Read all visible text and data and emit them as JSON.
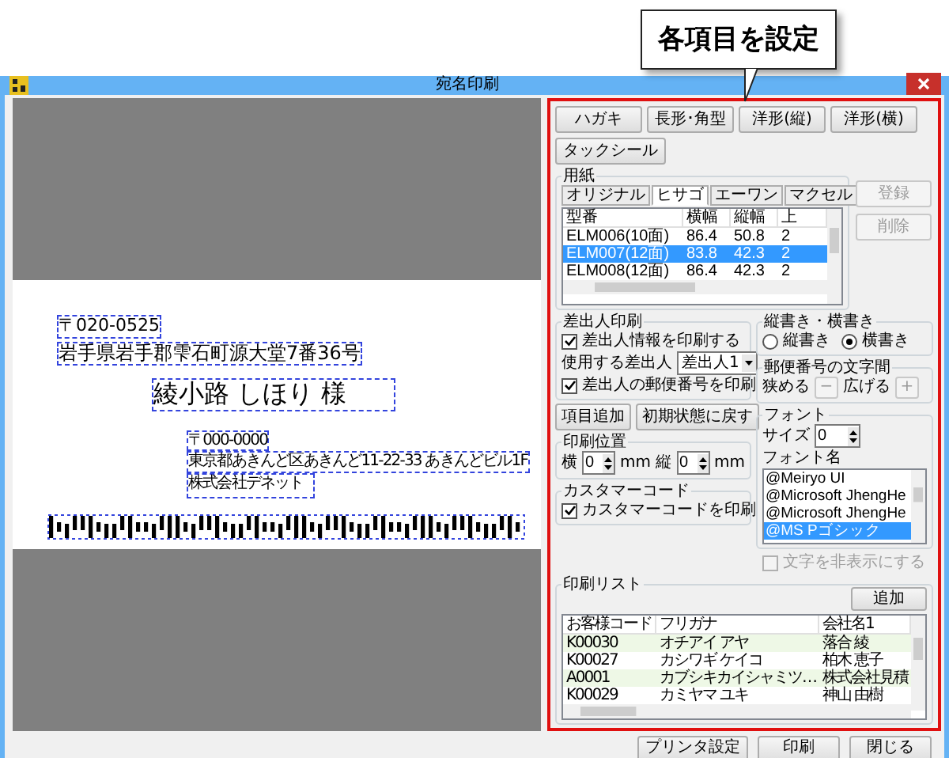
{
  "callout": {
    "text": "各項目を設定"
  },
  "window": {
    "title": "宛名印刷"
  },
  "preview": {
    "fields": [
      {
        "kind": "recipient_postal",
        "text": "〒020-0525"
      },
      {
        "kind": "recipient_address",
        "text": "岩手県岩手郡雫石町源大堂7番36号"
      },
      {
        "kind": "recipient_name",
        "text": "綾小路 しほり 様"
      },
      {
        "kind": "sender_postal",
        "text": "〒000-0000"
      },
      {
        "kind": "sender_address",
        "text": "東京都あきんど区あきんど11-22-33 あきんどビル1F"
      },
      {
        "kind": "sender_name",
        "text": "株式会社デネット"
      }
    ]
  },
  "size_buttons": [
    "ハガキ",
    "長形･角型",
    "洋形(縦)",
    "洋形(横)",
    "タックシール"
  ],
  "paper": {
    "label": "用紙",
    "tabs": [
      {
        "label": "オリジナル",
        "selected": false
      },
      {
        "label": "ヒサゴ",
        "selected": true
      },
      {
        "label": "エーワン",
        "selected": false
      },
      {
        "label": "マクセル",
        "selected": false
      }
    ],
    "columns": [
      "型番",
      "横幅",
      "縦幅",
      "上"
    ],
    "rows": [
      {
        "cells": [
          "ELM006(10面)",
          "86.4",
          "50.8",
          "2"
        ],
        "selected": false
      },
      {
        "cells": [
          "ELM007(12面)",
          "83.8",
          "42.3",
          "2"
        ],
        "selected": true
      },
      {
        "cells": [
          "ELM008(12面)",
          "86.4",
          "42.3",
          "2"
        ],
        "selected": false
      }
    ],
    "buttons": [
      {
        "label": "登録",
        "disabled": true
      },
      {
        "label": "削除",
        "disabled": true
      }
    ]
  },
  "sender": {
    "label": "差出人印刷",
    "print_sender": {
      "label": "差出人情報を印刷する",
      "checked": true
    },
    "select": {
      "label": "使用する差出人",
      "value": "差出人1"
    },
    "print_postal": {
      "label": "差出人の郵便番号を印刷",
      "checked": true
    }
  },
  "item_buttons": [
    "項目追加",
    "初期状態に戻す"
  ],
  "position": {
    "label": "印刷位置",
    "x_label": "横",
    "x_value": "0",
    "x_unit": "mm",
    "y_label": "縦",
    "y_value": "0",
    "y_unit": "mm"
  },
  "customer_code": {
    "label": "カスタマーコード",
    "checkbox": {
      "label": "カスタマーコードを印刷",
      "checked": true
    }
  },
  "orientation": {
    "label": "縦書き・横書き",
    "options": [
      {
        "label": "縦書き",
        "selected": false
      },
      {
        "label": "横書き",
        "selected": true
      }
    ]
  },
  "spacing": {
    "label": "郵便番号の文字間",
    "narrow_label": "狭める",
    "narrow_button": {
      "label": "−",
      "disabled": true
    },
    "widen_label": "広げる",
    "widen_button": {
      "label": "+",
      "disabled": true
    }
  },
  "font": {
    "label": "フォント",
    "size_label": "サイズ",
    "size_value": "0",
    "name_label": "フォント名",
    "names": [
      {
        "label": "@Meiryo UI",
        "selected": false
      },
      {
        "label": "@Microsoft JhengHe",
        "selected": false
      },
      {
        "label": "@Microsoft JhengHe",
        "selected": false
      },
      {
        "label": "@MS Pゴシック",
        "selected": true
      }
    ]
  },
  "hide_text": {
    "label": "文字を非表示にする",
    "checked": false,
    "disabled": true
  },
  "print_list": {
    "label": "印刷リスト",
    "add_button": "追加",
    "columns": [
      "お客様コード",
      "フリガナ",
      "会社名1"
    ],
    "rows": [
      [
        "K00030",
        "オチアイ アヤ",
        "落合 綾"
      ],
      [
        "K00027",
        "カシワギ ケイコ",
        "柏木 恵子"
      ],
      [
        "A0001",
        "カブシキカイシャミツ…",
        "株式会社見積"
      ],
      [
        "K00029",
        "カミヤマ ユキ",
        "神山 由樹"
      ]
    ]
  },
  "footer_buttons": [
    "プリンタ設定",
    "印刷",
    "閉じる"
  ]
}
